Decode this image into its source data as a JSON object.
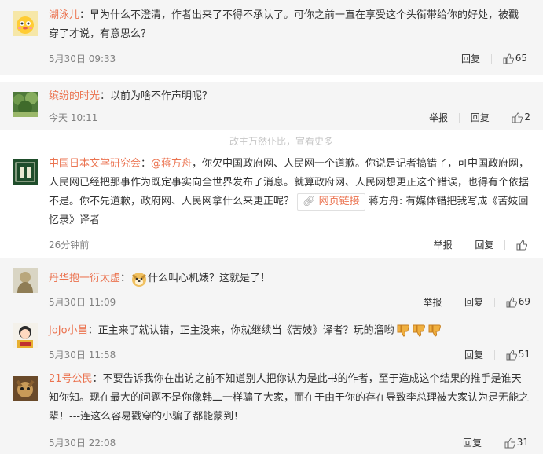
{
  "comments": [
    {
      "user": "湖泳儿",
      "sep": "：",
      "text": "早为什么不澄清，作者出来了不得不承认了。可你之前一直在享受这个头衔带给你的好处，被戳穿了才说，有意思么？",
      "time": "5月30日 09:33",
      "reply": "回复",
      "likes": "65"
    },
    {
      "user": "缤纷的时光",
      "sep": "：",
      "text": "以前为啥不作声明呢？",
      "time": "今天 10:11",
      "report": "举报",
      "reply": "回复",
      "likes": "2"
    },
    {
      "overlay": "改主万然仆比，宣看史多",
      "user": "中国日本文学研究会",
      "sep": "：",
      "mention": "@蒋方舟",
      "text_a": "，你欠中国政府网、人民网一个道歉。你说是记者搞错了，可中国政府网，人民网已经把那事作为既定事实向全世界发布了消息。就算政府网、人民网想更正这个错误，也得有个依据不是。你不先道歉，政府网、人民网拿什么来更正呢？",
      "weblink": "网页链接",
      "text_b": " 蒋方舟: 有媒体错把我写成《苦妓回忆录》译者",
      "time": "26分钟前",
      "report": "举报",
      "reply": "回复"
    },
    {
      "user": "丹华抱一衍太虚",
      "sep": "：",
      "text": "什么叫心机婊？这就是了！",
      "time": "5月30日 11:09",
      "report": "举报",
      "reply": "回复",
      "likes": "69"
    },
    {
      "user": "JoJo小昌",
      "sep": "：",
      "text": "正主来了就认错，正主没来，你就继续当《苦妓》译者？玩的溜哟",
      "time": "5月30日 11:58",
      "reply": "回复",
      "likes": "51"
    },
    {
      "user": "21号公民",
      "sep": "：",
      "text": "不要告诉我你在出访之前不知道别人把你认为是此书的作者，至于造成这个结果的推手是谁天知你知。现在最大的问题不是你像韩二一样骗了大家，而在于由于你的存在导致李总理被大家认为是无能之辈！---连这么容易戳穿的小骗子都能蒙到！",
      "time": "5月30日 22:08",
      "reply": "回复",
      "likes": "31"
    }
  ],
  "icons": {
    "like": "thumb-up-icon",
    "link": "chain-link-icon",
    "emoji_doge": "doge-emoji",
    "emoji_thumbs_down": "thumbs-down-emoji"
  },
  "colors": {
    "username": "#eb7350",
    "background": "#f5f5f5",
    "meta": "#808080"
  }
}
